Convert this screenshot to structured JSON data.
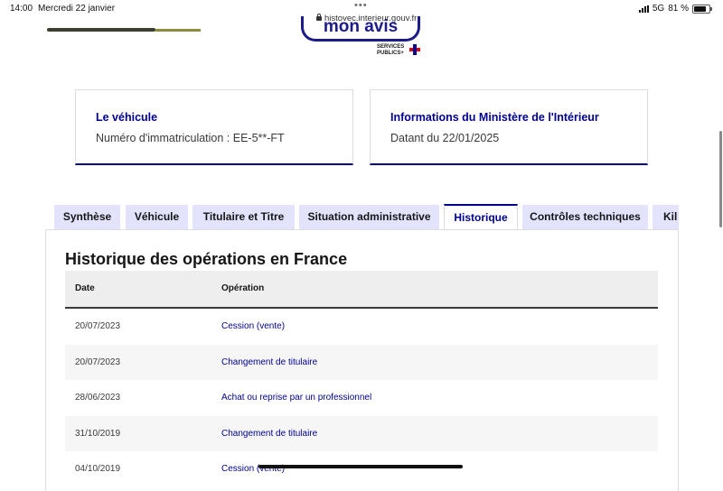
{
  "status_bar": {
    "time": "14:00",
    "date": "Mercredi 22 janvier",
    "url": "histovec.interieur.gouv.fr",
    "network": "5G",
    "battery": "81 %",
    "battery_level": 0.81
  },
  "header": {
    "feedback_button_label": "mon avis",
    "services_publics_logo_line1": "SERVICES",
    "services_publics_logo_line2": "PUBLICS+"
  },
  "cards": [
    {
      "title": "Le véhicule",
      "text": "Numéro d'immatriculation : EE-5**-FT"
    },
    {
      "title": "Informations du Ministère de l'Intérieur",
      "text": "Datant du 22/01/2025"
    }
  ],
  "tabs": [
    {
      "label": "Synthèse",
      "active": false
    },
    {
      "label": "Véhicule",
      "active": false
    },
    {
      "label": "Titulaire et Titre",
      "active": false
    },
    {
      "label": "Situation administrative",
      "active": false
    },
    {
      "label": "Historique",
      "active": true
    },
    {
      "label": "Contrôles techniques",
      "active": false
    },
    {
      "label": "Kil",
      "active": false
    }
  ],
  "section": {
    "title": "Historique des opérations en France"
  },
  "table": {
    "headers": {
      "date": "Date",
      "operation": "Opération"
    },
    "rows": [
      {
        "date": "20/07/2023",
        "operation": "Cession (vente)"
      },
      {
        "date": "20/07/2023",
        "operation": "Changement de titulaire"
      },
      {
        "date": "28/06/2023",
        "operation": "Achat ou reprise par un professionnel"
      },
      {
        "date": "31/10/2019",
        "operation": "Changement de titulaire"
      },
      {
        "date": "04/10/2019",
        "operation": "Cession (vente)"
      }
    ]
  },
  "colors": {
    "primary_blue": "#000091",
    "tab_inactive_bg": "#e3e3fd",
    "table_header_bg": "#eeeeee",
    "marianne_red": "#e1000f"
  }
}
